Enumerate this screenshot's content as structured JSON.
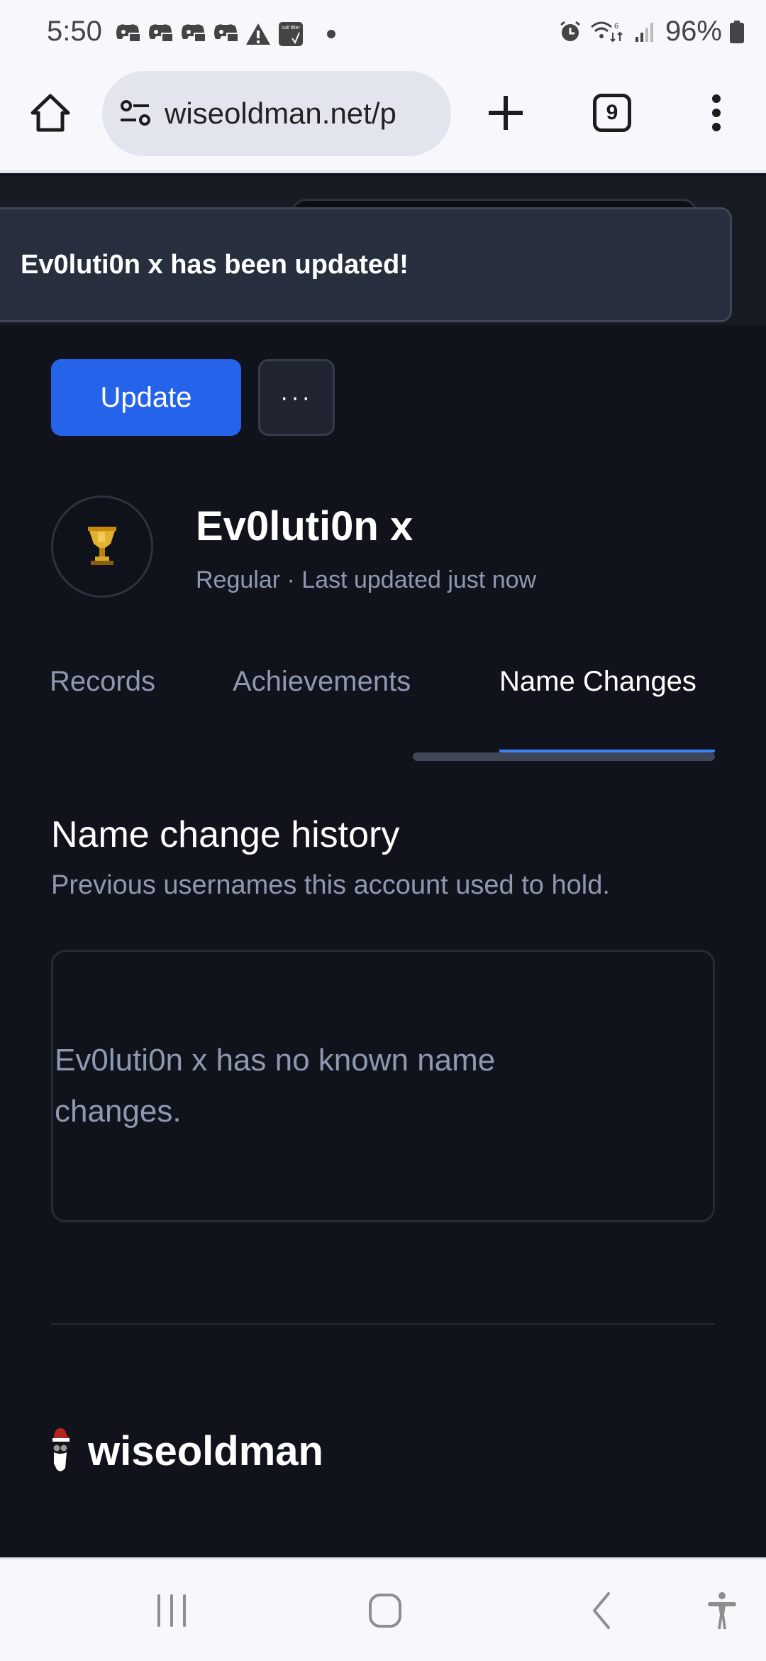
{
  "status_bar": {
    "time": "5:50",
    "notification_icons": [
      "discord-icon",
      "discord-icon",
      "discord-icon",
      "discord-icon",
      "warning-icon",
      "call-filter-icon"
    ],
    "call_filter_label": "call filter",
    "battery_percent": "96%",
    "wifi_label": "6"
  },
  "browser": {
    "url": "wiseoldman.net/p",
    "tab_count": "9"
  },
  "toast": {
    "message": "Ev0luti0n x has been updated!"
  },
  "actions": {
    "update_label": "Update",
    "more_label": "···"
  },
  "player": {
    "name": "Ev0luti0n x",
    "meta": "Regular · Last updated just now",
    "avatar_icon": "trophy-icon"
  },
  "tabs": [
    {
      "label": "Records",
      "active": false
    },
    {
      "label": "Achievements",
      "active": false
    },
    {
      "label": "Name Changes",
      "active": true
    }
  ],
  "section": {
    "title": "Name change history",
    "subtitle": "Previous usernames this account used to hold.",
    "empty_message": "Ev0luti0n x has no known name changes."
  },
  "footer": {
    "brand": "wiseoldman"
  },
  "colors": {
    "accent": "#2563eb",
    "tab_indicator": "#3b82f6",
    "background": "#10131b",
    "muted_text": "#8e98b0",
    "toast_bg": "#272e3e"
  }
}
